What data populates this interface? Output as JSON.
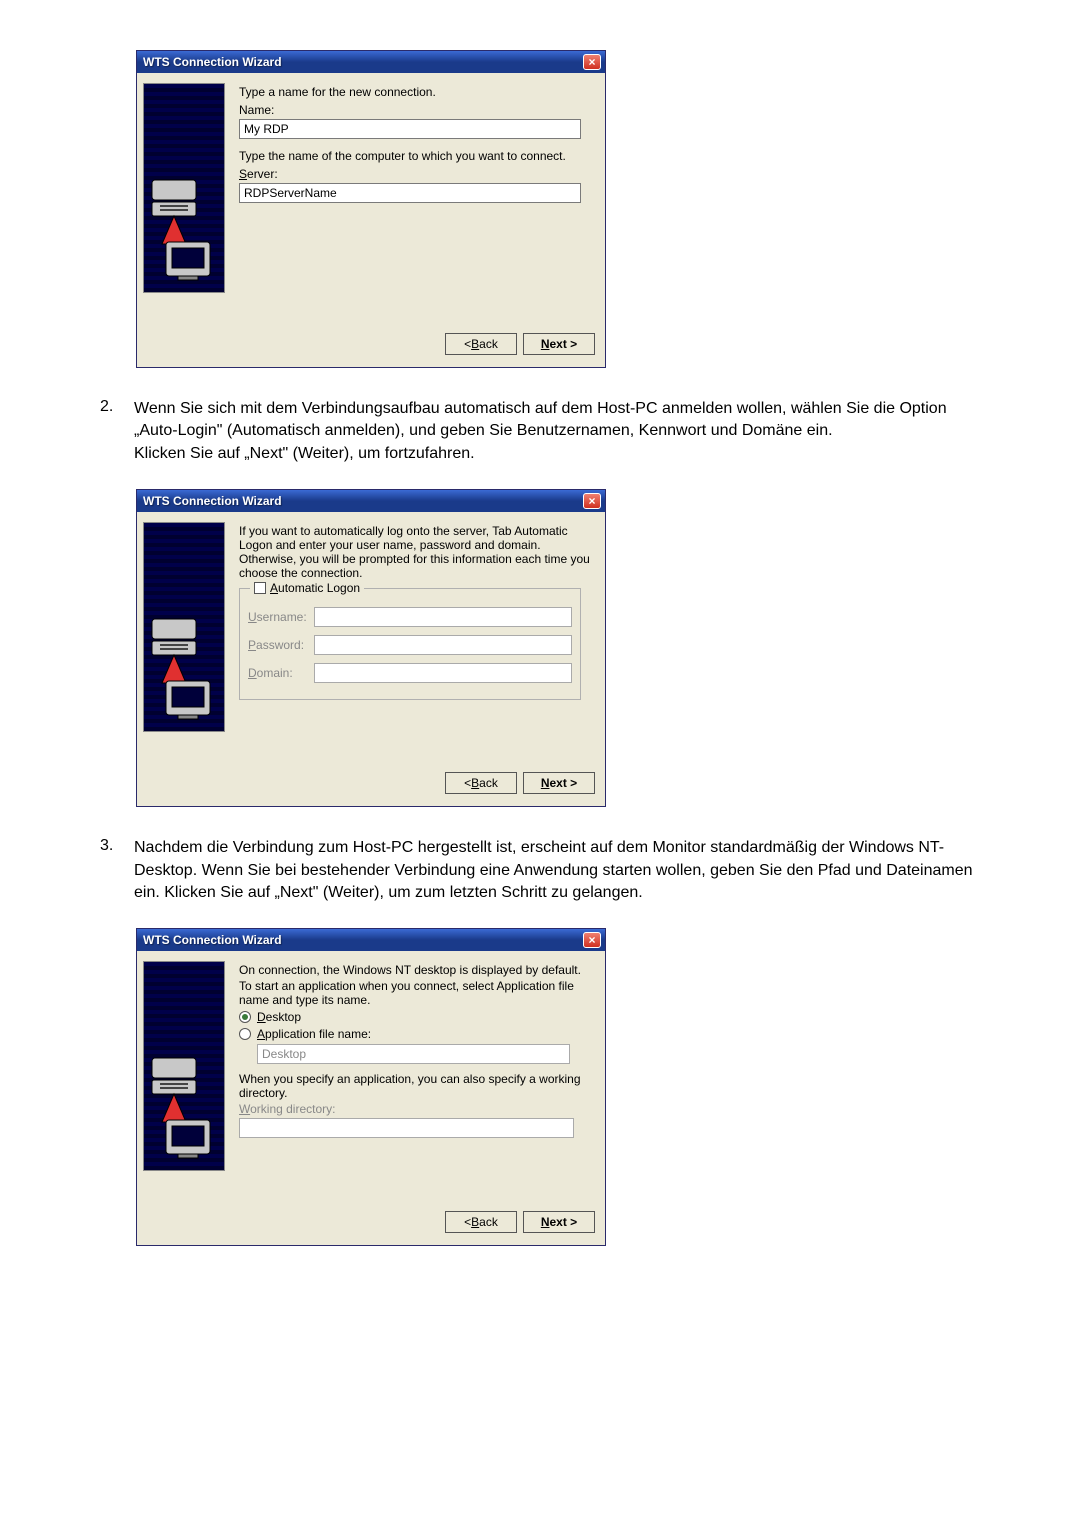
{
  "wizard_title": "WTS Connection Wizard",
  "buttons": {
    "back": "< Back",
    "next": "Next >"
  },
  "screen1": {
    "instr1": "Type a name for the new connection.",
    "name_label": "Name:",
    "name_value": "My RDP",
    "instr2": "Type the name of the computer to which you want to connect.",
    "server_label": "Server:",
    "server_value": "RDPServerName"
  },
  "step2": {
    "num": "2.",
    "text_l1": "Wenn Sie sich mit dem Verbindungsaufbau automatisch auf dem Host-PC anmelden wollen, wählen Sie die Option „Auto-Login\" (Automatisch anmelden), und geben Sie Benutzernamen, Kennwort und Domäne ein.",
    "text_l2": "Klicken Sie auf „Next\" (Weiter), um fortzufahren."
  },
  "screen2": {
    "instr": "If you want to automatically log onto the server, Tab Automatic Logon and enter your user name, password and domain. Otherwise, you will be prompted for this information each time you choose the connection.",
    "auto_logon": "Automatic Logon",
    "username": "Username:",
    "password": "Password:",
    "domain": "Domain:"
  },
  "step3": {
    "num": "3.",
    "text": "Nachdem die Verbindung zum Host-PC hergestellt ist, erscheint auf dem Monitor standardmäßig der Windows NT-Desktop. Wenn Sie bei bestehender Verbindung eine Anwendung starten wollen, geben Sie den Pfad und Dateinamen ein. Klicken Sie auf „Next\" (Weiter), um zum letzten Schritt zu gelangen."
  },
  "screen3": {
    "instr1": "On connection, the Windows NT desktop is displayed by default.",
    "instr2": "To start an application when you connect, select Application file name and type its name.",
    "opt_desktop": "Desktop",
    "opt_app": "Application file name:",
    "app_field_value": "Desktop",
    "instr3": "When you specify an application, you can also specify a working directory.",
    "working_dir": "Working directory:"
  }
}
